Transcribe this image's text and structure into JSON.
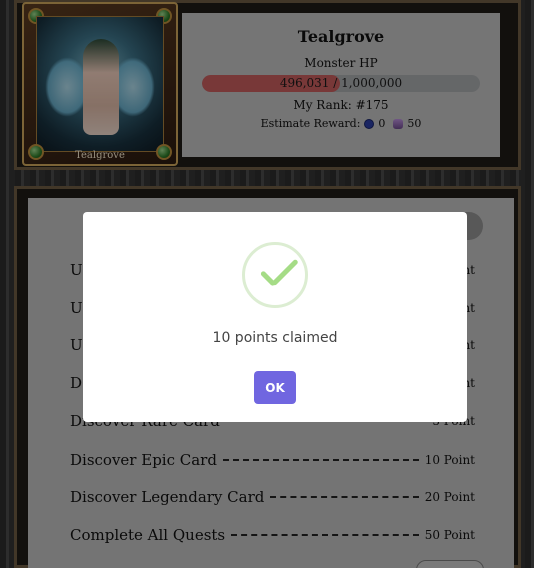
{
  "boss": {
    "card_name": "Tealgrove",
    "name": "Tealgrove",
    "hp_label": "Monster HP",
    "hp_text": "496,031 / 1,000,000",
    "hp_fraction": 0.496,
    "rank_text": "My Rank: #175",
    "reward_label": "Estimate Reward:",
    "reward_coin": "0",
    "reward_gem": "50"
  },
  "quests": [
    {
      "name": "U",
      "points": "Point"
    },
    {
      "name": "U",
      "points": "Point"
    },
    {
      "name": "U",
      "points": "Point"
    },
    {
      "name": "D",
      "points": "Point"
    },
    {
      "name": "Discover Rare Card",
      "points": "5 Point"
    },
    {
      "name": "Discover Epic Card",
      "points": "10 Point"
    },
    {
      "name": "Discover Legendary Card",
      "points": "20 Point"
    },
    {
      "name": "Complete All Quests",
      "points": "50 Point"
    }
  ],
  "modal": {
    "title": "10 points claimed",
    "ok_label": "OK",
    "icon": "success-check-icon",
    "button_color": "#7066e0",
    "check_color": "#a5dc86"
  }
}
